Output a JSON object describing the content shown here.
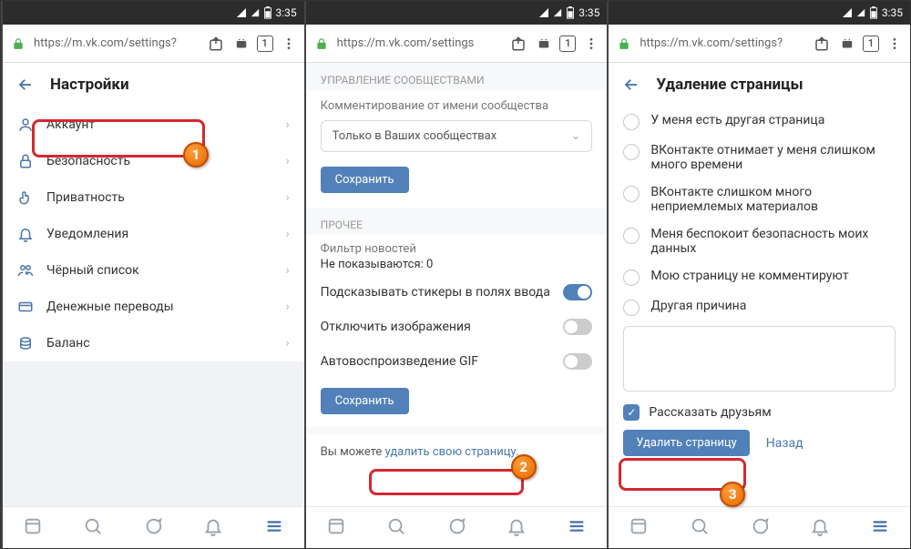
{
  "statusbar": {
    "time": "3:35"
  },
  "browser": {
    "url1": "https://m.vk.com/settings?",
    "url2": "https://m.vk.com/settings",
    "url3": "https://m.vk.com/settings?",
    "tabcount": "1"
  },
  "p1": {
    "title": "Настройки",
    "items": [
      "Аккаунт",
      "Безопасность",
      "Приватность",
      "Уведомления",
      "Чёрный список",
      "Денежные переводы",
      "Баланс"
    ]
  },
  "p2": {
    "sect1": "УПРАВЛЕНИЕ СООБЩЕСТВАМИ",
    "comment_label": "Комментирование от имени сообщества",
    "select_val": "Только в Ваших сообществах",
    "save": "Сохранить",
    "sect2": "ПРОЧЕЕ",
    "filter_label": "Фильтр новостей",
    "filter_val": "Не показываются: 0",
    "tog1": "Подсказывать стикеры в полях ввода",
    "tog2": "Отключить изображения",
    "tog3": "Автовоспроизведение GIF",
    "foot_pre": "Вы можете ",
    "foot_link": "удалить свою страницу."
  },
  "p3": {
    "title": "Удаление страницы",
    "r1": "У меня есть другая страница",
    "r2": "ВКонтакте отнимает у меня слишком много времени",
    "r3": "ВКонтакте слишком много неприемлемых материалов",
    "r4": "Меня беспокоит безопасность моих данных",
    "r5": "Мою страницу не комментируют",
    "r6": "Другая причина",
    "tell": "Рассказать друзьям",
    "del": "Удалить страницу",
    "back": "Назад"
  }
}
